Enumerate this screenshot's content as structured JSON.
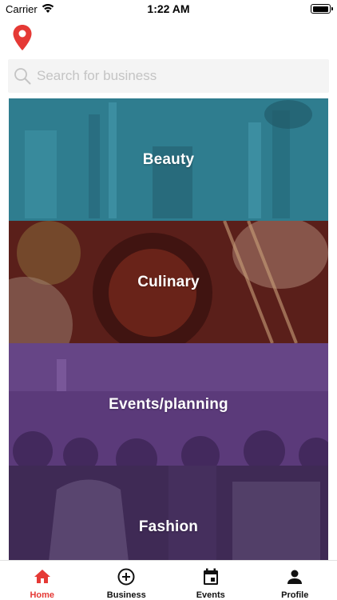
{
  "status_bar": {
    "carrier": "Carrier",
    "time": "1:22 AM"
  },
  "header": {
    "location_icon": "map-pin-icon"
  },
  "search": {
    "placeholder": "Search for business",
    "value": ""
  },
  "categories": [
    {
      "label": "Beauty",
      "overlay_color": "#2f7d8f"
    },
    {
      "label": "Culinary",
      "overlay_color": "#5a1f1a"
    },
    {
      "label": "Events/planning",
      "overlay_color": "#5b3a7a"
    },
    {
      "label": "Fashion",
      "overlay_color": "#3f2a55"
    }
  ],
  "tabbar": {
    "items": [
      {
        "label": "Home",
        "icon": "home-icon",
        "active": true
      },
      {
        "label": "Business",
        "icon": "add-circle-icon",
        "active": false
      },
      {
        "label": "Events",
        "icon": "calendar-icon",
        "active": false
      },
      {
        "label": "Profile",
        "icon": "person-icon",
        "active": false
      }
    ]
  },
  "colors": {
    "accent": "#e53935",
    "search_bg": "#f4f4f4"
  }
}
